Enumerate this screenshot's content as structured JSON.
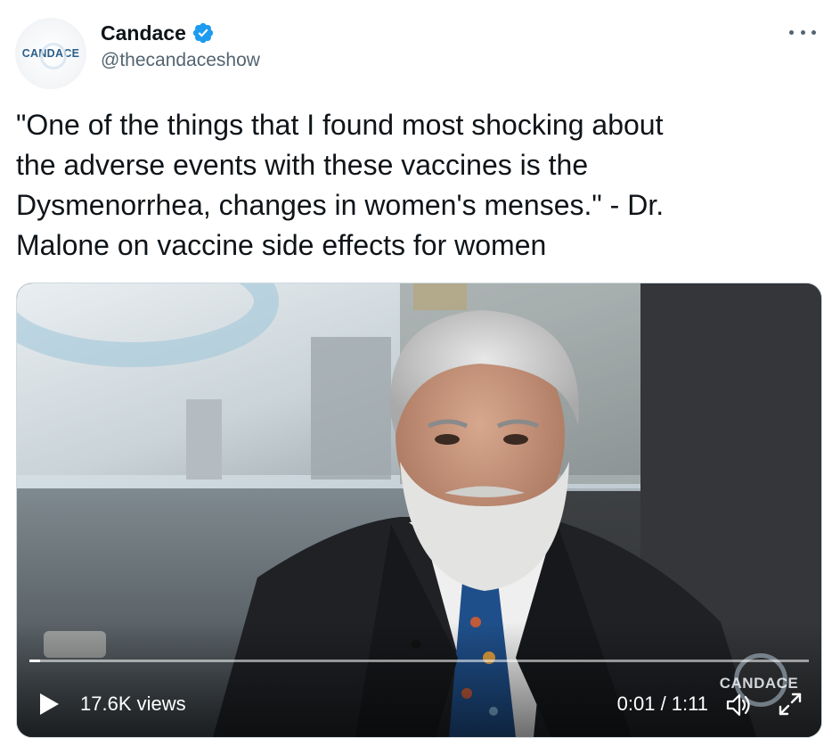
{
  "author": {
    "avatar_text": "CANDACE",
    "display_name": "Candace",
    "handle": "@thecandaceshow",
    "verified": true
  },
  "tweet": {
    "text": "\"One of the things that I found most shocking about\nthe adverse events with these vaccines is the\nDysmenorrhea, changes in women's menses.\" - Dr.\nMalone on vaccine side effects for women"
  },
  "video": {
    "views": "17.6K views",
    "time": "0:01 / 1:11",
    "progress": 0.014,
    "watermark": "CANDACE"
  },
  "icons": {
    "more": "more-icon",
    "verified": "verified-badge-icon",
    "play": "play-icon",
    "volume": "volume-icon",
    "fullscreen": "fullscreen-icon"
  },
  "colors": {
    "text": "#0f1419",
    "secondary": "#536471",
    "verified": "#1d9bf0"
  }
}
